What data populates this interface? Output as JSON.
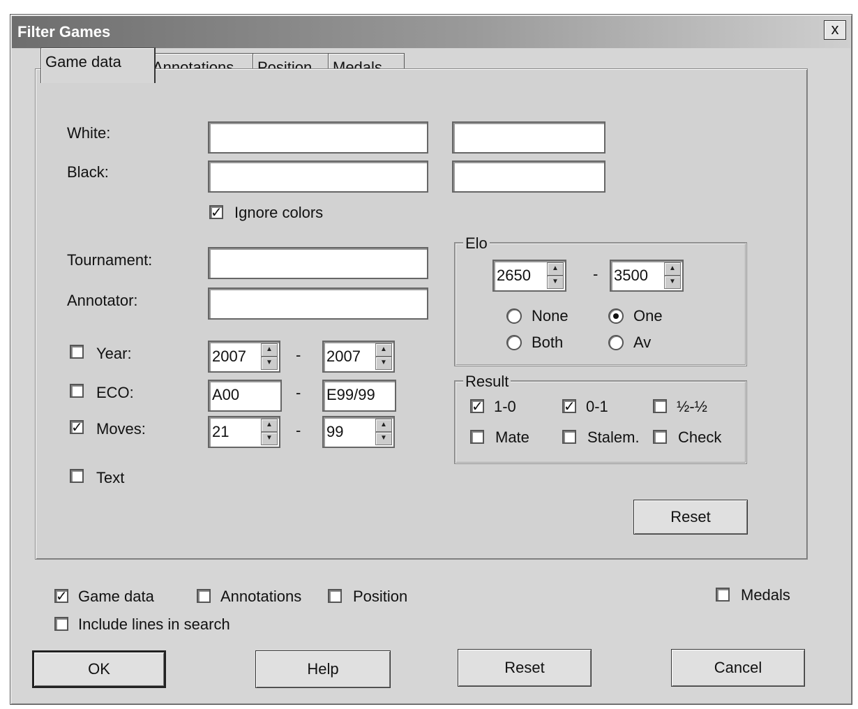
{
  "window": {
    "title": "Filter Games",
    "close_label": "x"
  },
  "tabs": [
    "Game data",
    "Annotations",
    "Position",
    "Medals"
  ],
  "players": {
    "white_label": "White:",
    "black_label": "Black:",
    "ignore_colors_label": "Ignore colors",
    "ignore_colors_checked": true,
    "white_value_1": "",
    "white_value_2": "",
    "black_value_1": "",
    "black_value_2": ""
  },
  "tournament": {
    "label": "Tournament:",
    "value": ""
  },
  "annotator": {
    "label": "Annotator:",
    "value": ""
  },
  "year": {
    "label": "Year:",
    "checked": false,
    "from": "2007",
    "to": "2007"
  },
  "eco": {
    "label": "ECO:",
    "checked": false,
    "from": "A00",
    "to": "E99/99"
  },
  "moves": {
    "label": "Moves:",
    "checked": true,
    "from": "21",
    "to": "99"
  },
  "text": {
    "label": "Text",
    "checked": false
  },
  "range_separator": "-",
  "elo": {
    "title": "Elo",
    "from": "2650",
    "to": "3500",
    "none_label": "None",
    "one_label": "One",
    "both_label": "Both",
    "av_label": "Av",
    "selected": "One"
  },
  "result": {
    "title": "Result",
    "white_win": {
      "label": "1-0",
      "checked": true
    },
    "black_win": {
      "label": "0-1",
      "checked": true
    },
    "draw": {
      "label": "½-½",
      "checked": false
    },
    "mate": {
      "label": "Mate",
      "checked": false
    },
    "stalemate": {
      "label": "Stalem.",
      "checked": false
    },
    "check": {
      "label": "Check",
      "checked": false
    }
  },
  "panel_reset_label": "Reset",
  "search_scope": {
    "game_data": {
      "label": "Game data",
      "checked": true
    },
    "annotations": {
      "label": "Annotations",
      "checked": false
    },
    "position": {
      "label": "Position",
      "checked": false
    },
    "medals": {
      "label": "Medals",
      "checked": false
    },
    "include_lines": {
      "label": "Include lines in search",
      "checked": false
    }
  },
  "buttons": {
    "ok": "OK",
    "help": "Help",
    "reset": "Reset",
    "cancel": "Cancel"
  }
}
